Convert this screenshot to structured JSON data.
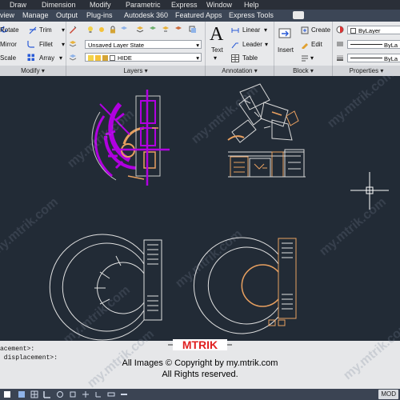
{
  "menu": [
    "Draw",
    "Dimension",
    "Modify",
    "Parametric",
    "Express",
    "Window",
    "Help"
  ],
  "tabs": [
    "view",
    "Manage",
    "Output",
    "Plug-ins",
    "Autodesk 360",
    "Featured Apps",
    "Express Tools"
  ],
  "ribbon": {
    "modify": {
      "header": "Modify",
      "rotate": "Rotate",
      "trim": "Trim",
      "mirror": "Mirror",
      "fillet": "Fillet",
      "scale": "Scale",
      "array": "Array"
    },
    "layers": {
      "header": "Layers",
      "layer_state": "Unsaved Layer State",
      "current_layer": "HIDE"
    },
    "annotation": {
      "header": "Annotation",
      "text": "Text",
      "linear": "Linear",
      "leader": "Leader",
      "table": "Table"
    },
    "block": {
      "header": "Block",
      "insert": "Insert",
      "create": "Create",
      "edit": "Edit"
    },
    "properties": {
      "header": "Properties",
      "color": "ByLayer",
      "linetype": "ByLa",
      "lineweight": "ByLa"
    }
  },
  "command_lines": [
    "acement>:",
    " displacement>:"
  ],
  "copyright": {
    "logo": "MTRIK",
    "line1": "All Images © Copyright by my.mtrik.com",
    "line2": "All Rights reserved."
  },
  "watermark": "my.mtrik.com",
  "status": {
    "model": "MOD"
  },
  "colors": {
    "canvas": "#222b36",
    "accent_magenta": "#b000e0",
    "drawing_orange": "#e8a060",
    "ribbon": "#e8e9eb"
  }
}
